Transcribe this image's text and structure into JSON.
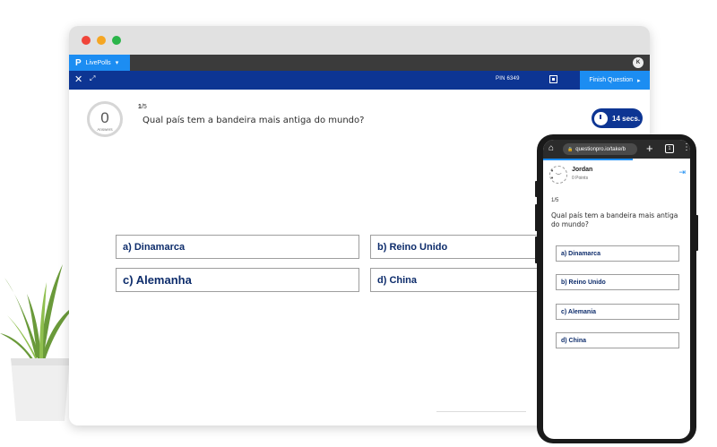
{
  "app": {
    "logo": "P",
    "name": "LivePolls",
    "dropdown_glyph": "▾",
    "profile_initial": "K"
  },
  "toolbar": {
    "close_glyph": "✕",
    "expand_glyph": "⤢",
    "pin": "PIN 6349",
    "finish_label": "Finish Question",
    "finish_arrow": "▸"
  },
  "question": {
    "answers_count": "0",
    "answers_label": "Answers",
    "current": "1",
    "total": "/5",
    "text": "Qual país tem a bandeira mais antiga do mundo?",
    "timer": "14 secs."
  },
  "options": [
    {
      "label": "a) Dinamarca"
    },
    {
      "label": "b) Reino Unido"
    },
    {
      "label": "c) Alemanha"
    },
    {
      "label": "d) China"
    }
  ],
  "mobile": {
    "url": "questionpro.io/take/b",
    "lock_glyph": "🔒",
    "home_glyph": "⌂",
    "plus_glyph": "+",
    "tabs_count": "1",
    "menu_glyph": "⋮",
    "user_name": "Jordan",
    "user_points": "0 Points",
    "avatar_glyph": "• ‿ •",
    "exit_glyph": "⇥",
    "question_num": "1/5",
    "question_text": "Qual país tem a bandeira mais antiga do mundo?",
    "options": [
      {
        "label": "a) Dinamarca"
      },
      {
        "label": "b) Reino Unido"
      },
      {
        "label": "c) Alemania"
      },
      {
        "label": "d) China"
      }
    ]
  },
  "colors": {
    "toolbar_navy": "#0d3593",
    "accent_blue": "#1c8df2",
    "answer_text": "#0d2c6b"
  }
}
